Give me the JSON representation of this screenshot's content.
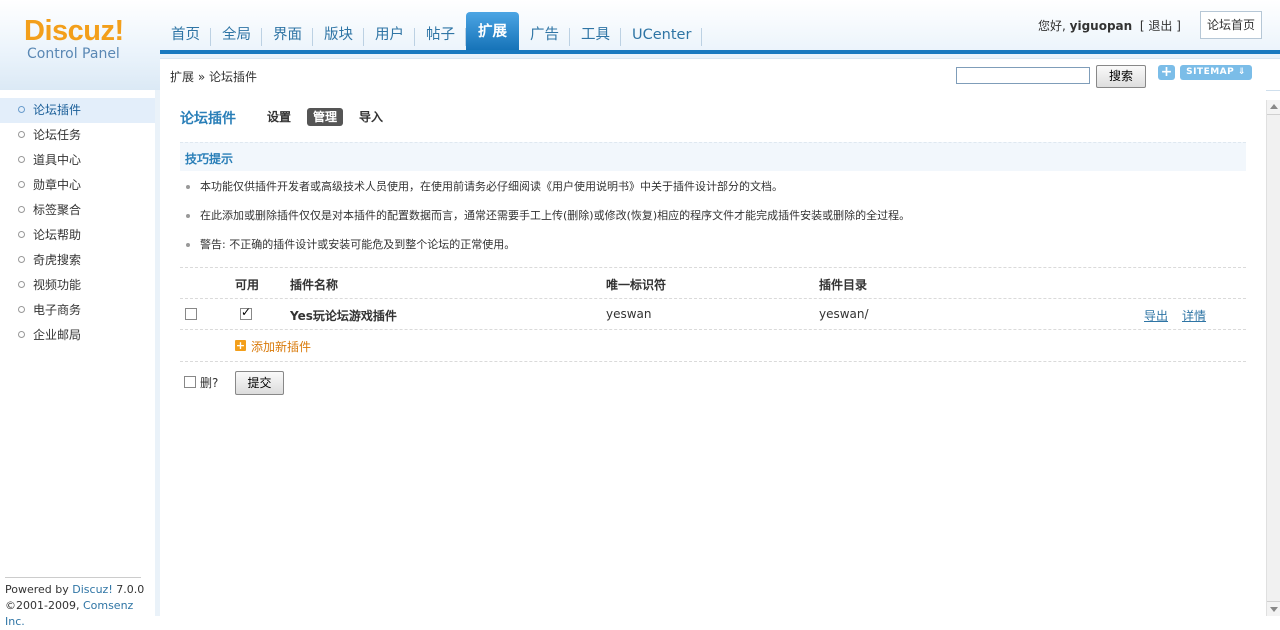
{
  "logo": {
    "main": "Discuz!",
    "sub": "Control Panel"
  },
  "nav": {
    "items": [
      {
        "label": "首页"
      },
      {
        "label": "全局"
      },
      {
        "label": "界面"
      },
      {
        "label": "版块"
      },
      {
        "label": "用户"
      },
      {
        "label": "帖子"
      },
      {
        "label": "扩展"
      },
      {
        "label": "广告"
      },
      {
        "label": "工具"
      },
      {
        "label": "UCenter"
      }
    ],
    "active_index": 6
  },
  "userbar": {
    "greeting": "您好,",
    "username": "yiguopan",
    "logout_open": "[",
    "logout": "退出",
    "logout_close": "]",
    "home": "论坛首页"
  },
  "breadcrumb": {
    "text": "扩展 » 论坛插件"
  },
  "search": {
    "value": "",
    "button": "搜索"
  },
  "toolbar": {
    "plus": "+",
    "sitemap": "SITEMAP ⇓"
  },
  "sidebar": {
    "items": [
      {
        "label": "论坛插件",
        "active": true
      },
      {
        "label": "论坛任务"
      },
      {
        "label": "道具中心"
      },
      {
        "label": "勋章中心"
      },
      {
        "label": "标签聚合"
      },
      {
        "label": "论坛帮助"
      },
      {
        "label": "奇虎搜索"
      },
      {
        "label": "视频功能"
      },
      {
        "label": "电子商务"
      },
      {
        "label": "企业邮局"
      }
    ],
    "powered_prefix": "Powered by ",
    "powered_link": "Discuz!",
    "powered_version": " 7.0.0",
    "copyright_prefix": "©2001-2009, ",
    "copyright_link": "Comsenz Inc."
  },
  "main": {
    "title": "论坛插件",
    "tabs": [
      {
        "label": "设置"
      },
      {
        "label": "管理",
        "active": true
      },
      {
        "label": "导入"
      }
    ],
    "tip_title": "技巧提示",
    "tips": [
      "本功能仅供插件开发者或高级技术人员使用，在使用前请务必仔细阅读《用户使用说明书》中关于插件设计部分的文档。",
      "在此添加或删除插件仅仅是对本插件的配置数据而言，通常还需要手工上传(删除)或修改(恢复)相应的程序文件才能完成插件安装或删除的全过程。",
      "警告: 不正确的插件设计或安装可能危及到整个论坛的正常使用。"
    ],
    "table": {
      "headers": {
        "enabled": "可用",
        "name": "插件名称",
        "identifier": "唯一标识符",
        "dir": "插件目录"
      },
      "rows": [
        {
          "delete_checked": false,
          "enabled": true,
          "name": "Yes玩论坛游戏插件",
          "identifier": "yeswan",
          "dir": "yeswan/",
          "export": "导出",
          "detail": "详情"
        }
      ],
      "add_label": "添加新插件"
    },
    "delete_label": "删?",
    "submit": "提交"
  },
  "colors": {
    "accent": "#1a7ac0",
    "logo": "#f39f1b",
    "link": "#2f75a5"
  }
}
